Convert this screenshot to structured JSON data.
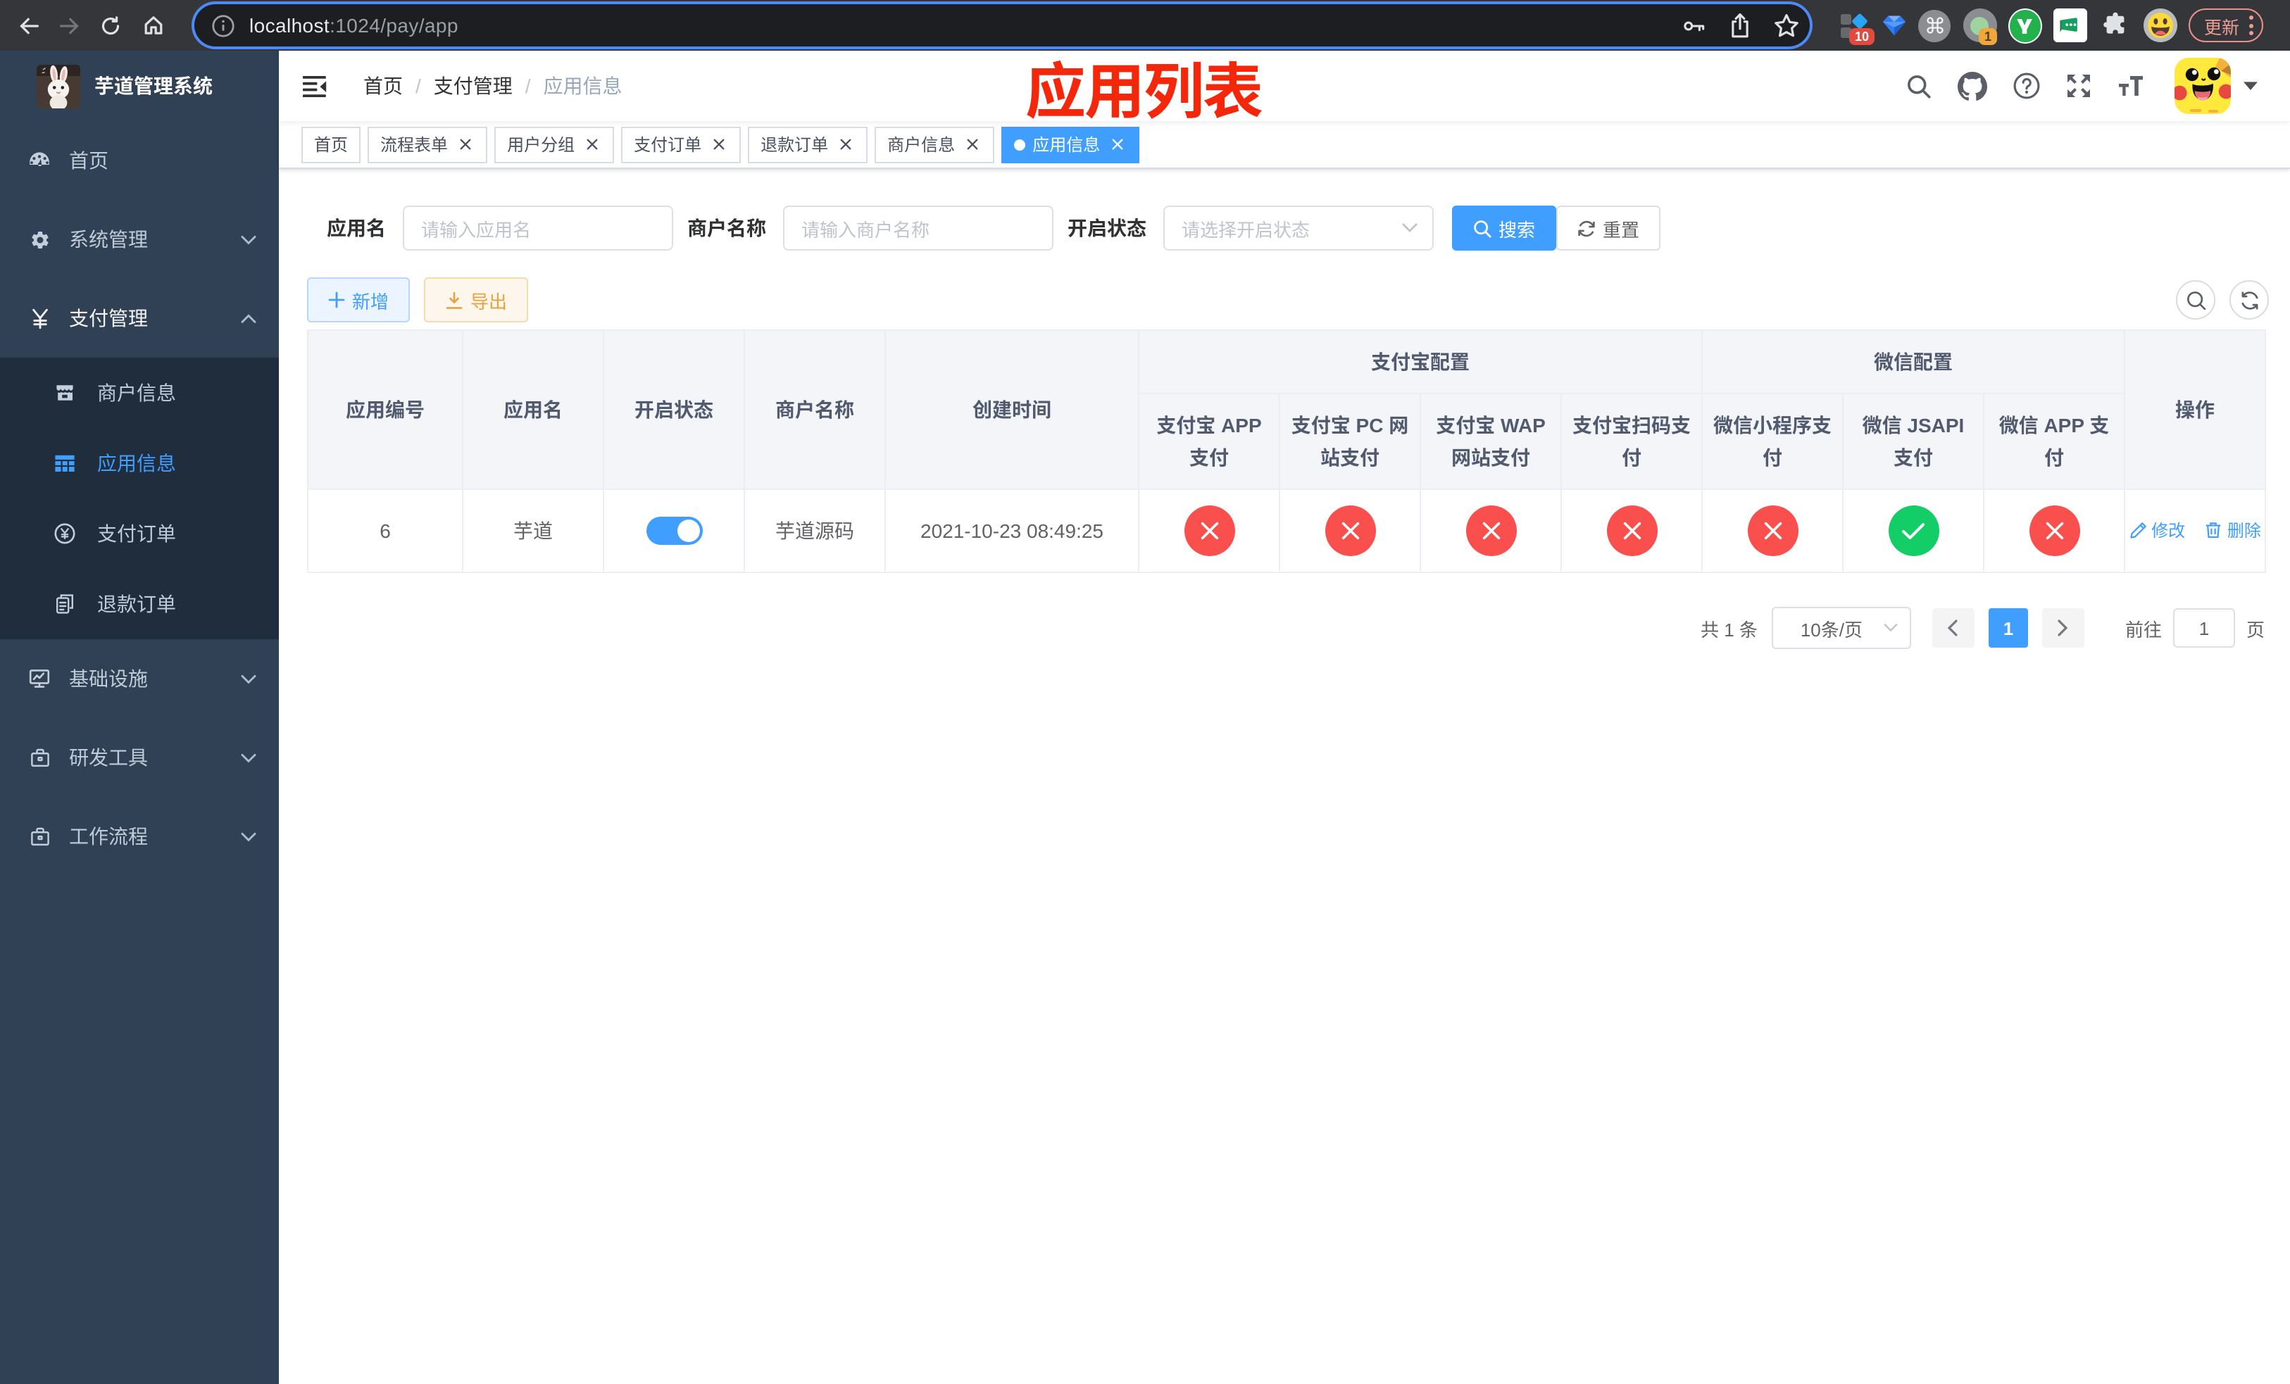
{
  "browser": {
    "url_host": "localhost",
    "url_path": ":1024/pay/app",
    "update_label": "更新",
    "extension_badge_count": "10",
    "notification_badge_count": "1"
  },
  "sidebar": {
    "logo_title": "芋道管理系统",
    "items": [
      {
        "label": "首页",
        "icon": "dashboard-icon"
      },
      {
        "label": "系统管理",
        "icon": "gear-icon",
        "expandable": true
      },
      {
        "label": "支付管理",
        "icon": "yen-icon",
        "expandable": true,
        "expanded": true
      },
      {
        "label": "基础设施",
        "icon": "monitor-icon",
        "expandable": true
      },
      {
        "label": "研发工具",
        "icon": "toolbox-icon",
        "expandable": true
      },
      {
        "label": "工作流程",
        "icon": "briefcase-icon",
        "expandable": true
      }
    ],
    "pay_submenu": [
      {
        "label": "商户信息",
        "icon": "shop-icon"
      },
      {
        "label": "应用信息",
        "icon": "grid-icon",
        "active": true
      },
      {
        "label": "支付订单",
        "icon": "coin-icon"
      },
      {
        "label": "退款订单",
        "icon": "documents-icon"
      }
    ]
  },
  "navbar": {
    "breadcrumb": [
      {
        "label": "首页"
      },
      {
        "label": "支付管理"
      },
      {
        "label": "应用信息"
      }
    ],
    "annotation": "应用列表"
  },
  "tabs": [
    {
      "label": "首页",
      "closable": false,
      "active": false
    },
    {
      "label": "流程表单",
      "closable": true,
      "active": false
    },
    {
      "label": "用户分组",
      "closable": true,
      "active": false
    },
    {
      "label": "支付订单",
      "closable": true,
      "active": false
    },
    {
      "label": "退款订单",
      "closable": true,
      "active": false
    },
    {
      "label": "商户信息",
      "closable": true,
      "active": false
    },
    {
      "label": "应用信息",
      "closable": true,
      "active": true
    }
  ],
  "filters": {
    "app_name": {
      "label": "应用名",
      "placeholder": "请输入应用名",
      "value": ""
    },
    "merchant_name": {
      "label": "商户名称",
      "placeholder": "请输入商户名称",
      "value": ""
    },
    "status": {
      "label": "开启状态",
      "placeholder": "请选择开启状态",
      "value": ""
    },
    "search_label": "搜索",
    "reset_label": "重置"
  },
  "toolbar": {
    "add_label": "新增",
    "export_label": "导出"
  },
  "table": {
    "columns": {
      "app_id": "应用编号",
      "app_name": "应用名",
      "status": "开启状态",
      "merchant_name": "商户名称",
      "create_time": "创建时间",
      "alipay_group": "支付宝配置",
      "alipay_app": "支付宝 APP\n支付",
      "alipay_pc": "支付宝 PC 网\n站支付",
      "alipay_wap": "支付宝 WAP\n网站支付",
      "alipay_qr": "支付宝扫码支\n付",
      "wechat_group": "微信配置",
      "wechat_lite": "微信小程序支\n付",
      "wechat_jsapi": "微信 JSAPI\n支付",
      "wechat_app": "微信 APP 支\n付",
      "actions": "操作"
    },
    "rows": [
      {
        "app_id": "6",
        "app_name": "芋道",
        "status_on": true,
        "merchant_name": "芋道源码",
        "create_time": "2021-10-23 08:49:25",
        "alipay_app": false,
        "alipay_pc": false,
        "alipay_wap": false,
        "alipay_qr": false,
        "wechat_lite": false,
        "wechat_jsapi": true,
        "wechat_app": false,
        "edit_label": "修改",
        "delete_label": "删除"
      }
    ]
  },
  "pagination": {
    "total_text": "共 1 条",
    "page_size_text": "10条/页",
    "current_page": "1",
    "goto_label": "前往",
    "goto_value": "1",
    "page_unit": "页"
  },
  "colors": {
    "accent": "#409EFF",
    "danger": "#f9504e",
    "success": "#13ce66",
    "warning": "#e6a23c",
    "sidebar_bg": "#304156",
    "submenu_bg": "#1f2d3d",
    "annotation_red": "#f5270b"
  }
}
